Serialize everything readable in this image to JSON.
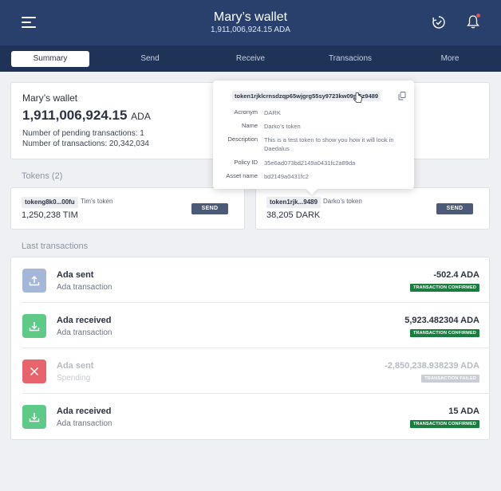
{
  "header": {
    "title": "Mary’s wallet",
    "subtitle": "1,911,006,924.15 ADA"
  },
  "nav": {
    "tabs": [
      "Summary",
      "Send",
      "Receive",
      "Transacions",
      "More"
    ],
    "active": "Summary"
  },
  "summary": {
    "wallet_name": "Mary’s wallet",
    "balance": "1,911,006,924.15",
    "balance_unit": "ADA",
    "pending_line": "Number of pending transactions: 1",
    "tx_count_line": "Number of transactions: 20,342,034"
  },
  "tokens": {
    "heading": "Tokens (2)",
    "items": [
      {
        "id_short": "tokeng8k0...00fu",
        "name": "Tim’s token",
        "amount": "1,250,238 TIM",
        "send_label": "SEND"
      },
      {
        "id_short": "token1rjk...9489",
        "name": "Darko’s token",
        "amount": "38,205 DARK",
        "send_label": "SEND"
      }
    ]
  },
  "tooltip": {
    "token_id": "token1rjklcrnsdzqp65wjgrg55sy9723kw09m5z9489",
    "rows": [
      {
        "key": "Acronym",
        "value": "DARK"
      },
      {
        "key": "Name",
        "value": "Darko’s token"
      },
      {
        "key": "Description",
        "value": "This is a test token to show you how it will look in Daedalus"
      },
      {
        "key": "Policy ID",
        "value": "35e6ad073bd2149a0431fc2a89da"
      },
      {
        "key": "Asset name",
        "value": "bd2149a0431fc2"
      }
    ]
  },
  "transactions": {
    "heading": "Last transactions",
    "items": [
      {
        "title": "Ada sent",
        "subtitle": "Ada transaction",
        "amount": "-502.4 ADA",
        "status": "TRANSACTION CONFIRMED",
        "icon": "upload-icon",
        "color": "#a5b7d9"
      },
      {
        "title": "Ada received",
        "subtitle": "Ada transaction",
        "amount": "5,923.482304 ADA",
        "status": "TRANSACTION CONFIRMED",
        "icon": "download-icon",
        "color": "#5fc987"
      },
      {
        "title": "Ada sent",
        "subtitle": "Spending",
        "amount": "-2,850,238.938239 ADA",
        "status": "TRANSACTION FAILED",
        "icon": "close-icon",
        "color": "#e8646d"
      },
      {
        "title": "Ada received",
        "subtitle": "Ada transaction",
        "amount": "15 ADA",
        "status": "TRANSACTION CONFIRMED",
        "icon": "download-icon",
        "color": "#5fc987"
      }
    ]
  },
  "colors": {
    "topbar": "#28406b",
    "nav": "#1f3257",
    "confirmed_badge": "#1a7c3f",
    "send_button": "#4b5a76"
  }
}
